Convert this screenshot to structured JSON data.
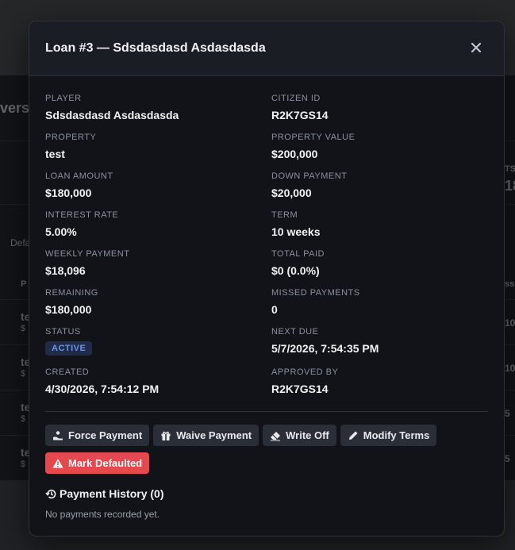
{
  "background": {
    "fragments": [
      "vers",
      "Defa",
      "P",
      "te",
      "te",
      "te",
      "te",
      "$",
      "$",
      "$",
      "$",
      "TS",
      "18",
      "ss",
      "10",
      "10",
      "5",
      "5"
    ]
  },
  "modal": {
    "title": "Loan #3 — Sdsdasdasd Asdasdasda",
    "fields": {
      "player": {
        "label": "PLAYER",
        "value": "Sdsdasdasd Asdasdasda"
      },
      "citizen_id": {
        "label": "CITIZEN ID",
        "value": "R2K7GS14"
      },
      "property": {
        "label": "PROPERTY",
        "value": "test"
      },
      "property_value": {
        "label": "PROPERTY VALUE",
        "value": "$200,000"
      },
      "loan_amount": {
        "label": "LOAN AMOUNT",
        "value": "$180,000"
      },
      "down_payment": {
        "label": "DOWN PAYMENT",
        "value": "$20,000"
      },
      "interest_rate": {
        "label": "INTEREST RATE",
        "value": "5.00%"
      },
      "term": {
        "label": "TERM",
        "value": "10 weeks"
      },
      "weekly_payment": {
        "label": "WEEKLY PAYMENT",
        "value": "$18,096"
      },
      "total_paid": {
        "label": "TOTAL PAID",
        "value": "$0 (0.0%)"
      },
      "remaining": {
        "label": "REMAINING",
        "value": "$180,000"
      },
      "missed_payments": {
        "label": "MISSED PAYMENTS",
        "value": "0"
      },
      "status": {
        "label": "STATUS",
        "value": "ACTIVE"
      },
      "next_due": {
        "label": "NEXT DUE",
        "value": "5/7/2026, 7:54:35 PM"
      },
      "created": {
        "label": "CREATED",
        "value": "4/30/2026, 7:54:12 PM"
      },
      "approved_by": {
        "label": "APPROVED BY",
        "value": "R2K7GS14"
      }
    },
    "actions": {
      "force_payment": "Force Payment",
      "waive_payment": "Waive Payment",
      "write_off": "Write Off",
      "modify_terms": "Modify Terms",
      "mark_defaulted": "Mark Defaulted"
    },
    "history": {
      "title": "Payment History (0)",
      "empty": "No payments recorded yet."
    },
    "colors": {
      "accent_active": "#6c93e6",
      "danger": "#e5484d"
    },
    "icons": {
      "close": "close-icon",
      "force_payment": "hand-coin-icon",
      "waive_payment": "gift-icon",
      "write_off": "eraser-icon",
      "modify_terms": "pencil-icon",
      "mark_defaulted": "warning-icon",
      "history": "history-icon"
    }
  }
}
